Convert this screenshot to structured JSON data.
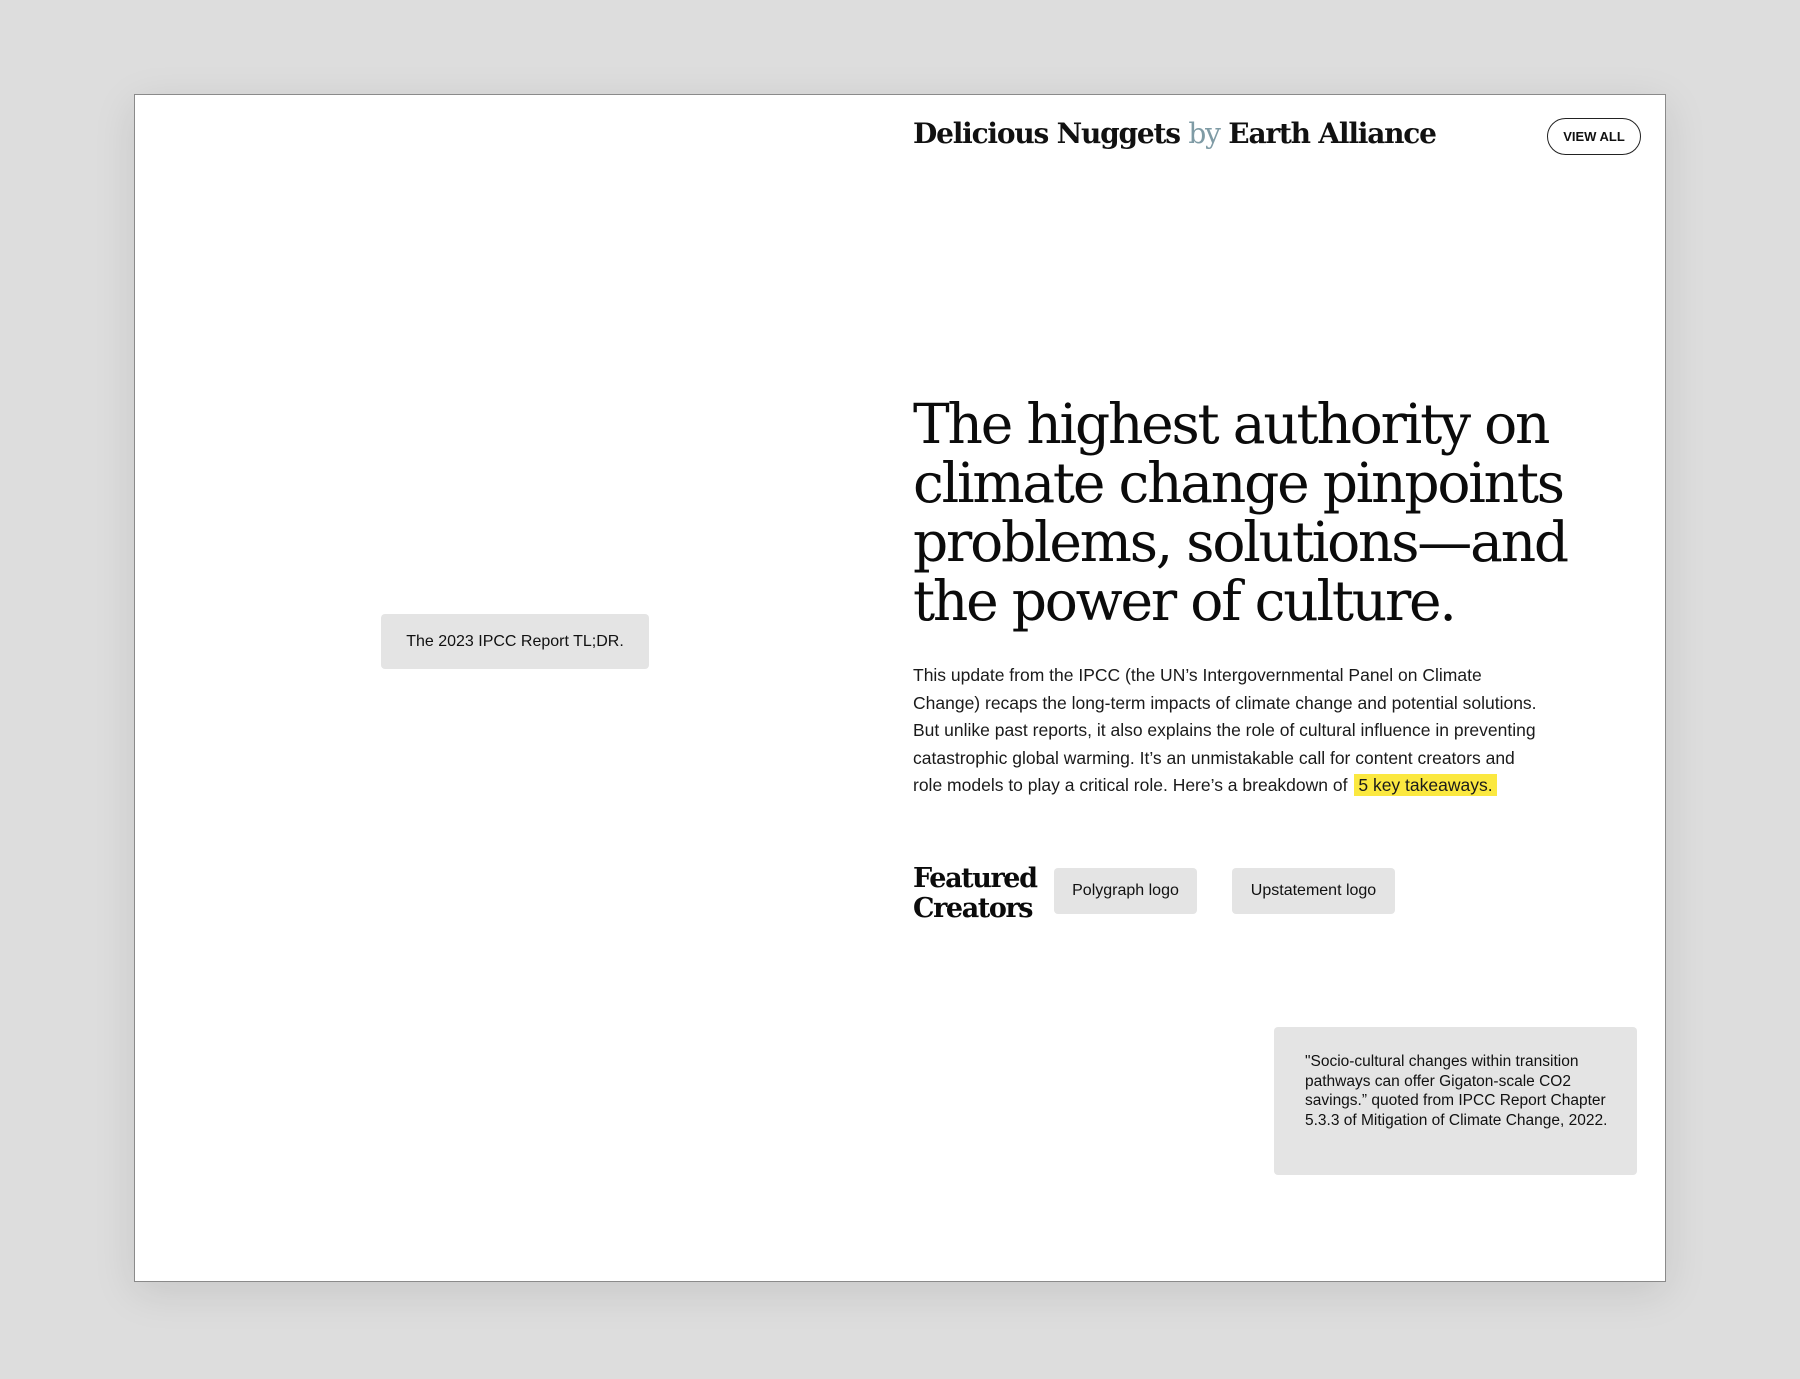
{
  "header": {
    "brand_part1": "Delicious Nuggets",
    "brand_by": "by",
    "brand_part2": "Earth Alliance",
    "view_all_label": "VIEW ALL"
  },
  "tldr_image_label": "The 2023 IPCC Report TL;DR.",
  "article": {
    "headline": "The highest authority on climate change pinpoints problems, solutions—and the power of culture.",
    "body": "This update from the IPCC (the UN’s Intergovernmental Panel on Climate Change) recaps the long-term impacts of climate change and potential solutions. But unlike past reports, it also explains the role of cultural influence in preventing catastrophic global warming. It’s an unmistakable call for content creators and role models to play a critical role. Here’s a breakdown of",
    "highlight_link": "5 key takeaways."
  },
  "featured": {
    "title_line1": "Featured",
    "title_line2": "Creators",
    "logos": [
      "Polygraph logo",
      "Upstatement logo"
    ]
  },
  "quote": "\"Socio-cultural changes within transition pathways can offer Gigaton-scale CO2 savings.” quoted from IPCC Report Chapter 5.3.3 of Mitigation of Climate Change, 2022.",
  "colors": {
    "page_background": "#dddddd",
    "card_background": "#ffffff",
    "placeholder_gray": "#e4e4e4",
    "brand_by_accent": "#7f9ba5",
    "highlight_yellow": "#fbe840"
  }
}
